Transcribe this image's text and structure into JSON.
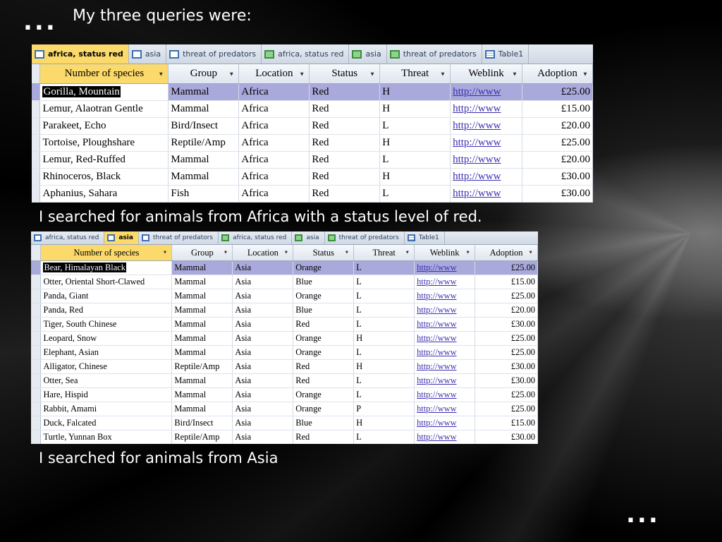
{
  "slide": {
    "dots_top": "...",
    "dots_bottom": "...",
    "heading": "My three queries were:",
    "caption1": "I searched for animals from Africa with a status level of red.",
    "caption2": "I searched for animals from Asia"
  },
  "query1": {
    "tabs": [
      {
        "label": "africa, status red",
        "icon": "query-icon",
        "active": true
      },
      {
        "label": "asia",
        "icon": "query-icon",
        "active": false
      },
      {
        "label": "threat of predators",
        "icon": "query-icon",
        "active": false
      },
      {
        "label": "africa, status red",
        "icon": "form-icon",
        "active": false
      },
      {
        "label": "asia",
        "icon": "form-icon",
        "active": false
      },
      {
        "label": "threat of predators",
        "icon": "form-icon",
        "active": false
      },
      {
        "label": "Table1",
        "icon": "table-icon",
        "active": false
      }
    ],
    "columns": [
      "Number of species",
      "Group",
      "Location",
      "Status",
      "Threat",
      "Weblink",
      "Adoption"
    ],
    "rows": [
      [
        "Gorilla, Mountain",
        "Mammal",
        "Africa",
        "Red",
        "H",
        "http://www",
        "£25.00"
      ],
      [
        "Lemur, Alaotran Gentle",
        "Mammal",
        "Africa",
        "Red",
        "H",
        "http://www",
        "£15.00"
      ],
      [
        "Parakeet, Echo",
        "Bird/Insect",
        "Africa",
        "Red",
        "L",
        "http://www",
        "£20.00"
      ],
      [
        "Tortoise, Ploughshare",
        "Reptile/Amp",
        "Africa",
        "Red",
        "H",
        "http://www",
        "£25.00"
      ],
      [
        "Lemur, Red-Ruffed",
        "Mammal",
        "Africa",
        "Red",
        "L",
        "http://www",
        "£20.00"
      ],
      [
        "Rhinoceros, Black",
        "Mammal",
        "Africa",
        "Red",
        "H",
        "http://www",
        "£30.00"
      ],
      [
        "Aphanius, Sahara",
        "Fish",
        "Africa",
        "Red",
        "L",
        "http://www",
        "£30.00"
      ]
    ]
  },
  "query2": {
    "tabs": [
      {
        "label": "africa, status red",
        "icon": "query-icon",
        "active": false
      },
      {
        "label": "asia",
        "icon": "query-icon",
        "active": true
      },
      {
        "label": "threat of predators",
        "icon": "query-icon",
        "active": false
      },
      {
        "label": "africa, status red",
        "icon": "form-icon",
        "active": false
      },
      {
        "label": "asia",
        "icon": "form-icon",
        "active": false
      },
      {
        "label": "threat of predators",
        "icon": "form-icon",
        "active": false
      },
      {
        "label": "Table1",
        "icon": "table-icon",
        "active": false
      }
    ],
    "columns": [
      "Number of species",
      "Group",
      "Location",
      "Status",
      "Threat",
      "Weblink",
      "Adoption"
    ],
    "rows": [
      [
        "Bear, Himalayan Black",
        "Mammal",
        "Asia",
        "Orange",
        "L",
        "http://www",
        "£25.00"
      ],
      [
        "Otter, Oriental Short-Clawed",
        "Mammal",
        "Asia",
        "Blue",
        "L",
        "http://www",
        "£15.00"
      ],
      [
        "Panda, Giant",
        "Mammal",
        "Asia",
        "Orange",
        "L",
        "http://www",
        "£25.00"
      ],
      [
        "Panda, Red",
        "Mammal",
        "Asia",
        "Blue",
        "L",
        "http://www",
        "£20.00"
      ],
      [
        "Tiger, South Chinese",
        "Mammal",
        "Asia",
        "Red",
        "L",
        "http://www",
        "£30.00"
      ],
      [
        "Leopard, Snow",
        "Mammal",
        "Asia",
        "Orange",
        "H",
        "http://www",
        "£25.00"
      ],
      [
        "Elephant, Asian",
        "Mammal",
        "Asia",
        "Orange",
        "L",
        "http://www",
        "£25.00"
      ],
      [
        "Alligator, Chinese",
        "Reptile/Amp",
        "Asia",
        "Red",
        "H",
        "http://www",
        "£30.00"
      ],
      [
        "Otter, Sea",
        "Mammal",
        "Asia",
        "Red",
        "L",
        "http://www",
        "£30.00"
      ],
      [
        "Hare, Hispid",
        "Mammal",
        "Asia",
        "Orange",
        "L",
        "http://www",
        "£25.00"
      ],
      [
        "Rabbit, Amami",
        "Mammal",
        "Asia",
        "Orange",
        "P",
        "http://www",
        "£25.00"
      ],
      [
        "Duck, Falcated",
        "Bird/Insect",
        "Asia",
        "Blue",
        "H",
        "http://www",
        "£15.00"
      ],
      [
        "Turtle, Yunnan Box",
        "Reptile/Amp",
        "Asia",
        "Red",
        "L",
        "http://www",
        "£30.00"
      ]
    ]
  },
  "colors": {
    "highlight_row": "#a9a9dc",
    "active_tab": "#fbd96a",
    "link": "#3b2fb0"
  }
}
